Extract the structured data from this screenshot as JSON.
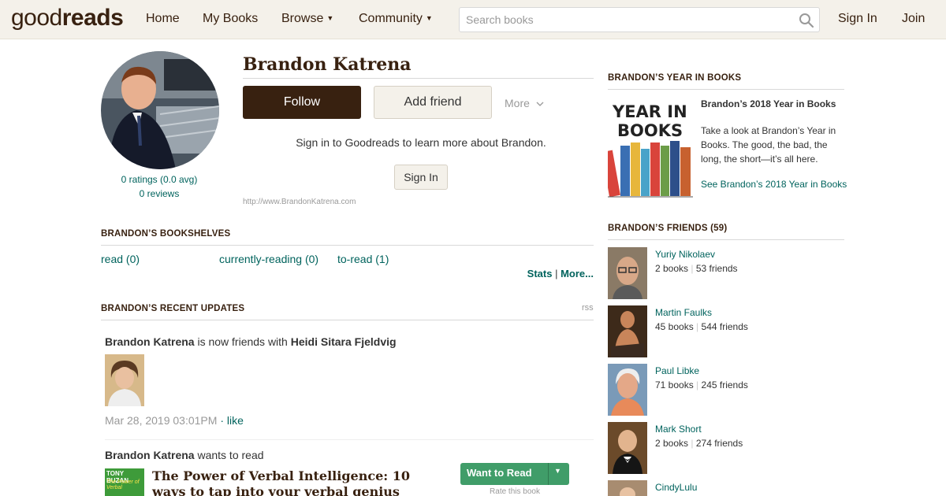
{
  "header": {
    "logo_light": "good",
    "logo_bold": "reads",
    "nav": [
      {
        "label": "Home"
      },
      {
        "label": "My Books"
      },
      {
        "label": "Browse"
      },
      {
        "label": "Community"
      }
    ],
    "search_placeholder": "Search books",
    "sign_in": "Sign In",
    "join": "Join"
  },
  "profile": {
    "name": "Brandon Katrena",
    "ratings": "0 ratings (0.0 avg)",
    "reviews": "0 reviews",
    "follow_label": "Follow",
    "add_friend_label": "Add friend",
    "more_label": "More",
    "signin_prompt": "Sign in to Goodreads to learn more about Brandon.",
    "signin_button": "Sign In",
    "website": "http://www.BrandonKatrena.com"
  },
  "bookshelves": {
    "title": "BRANDON’S BOOKSHELVES",
    "shelves": [
      {
        "label": "read (0)"
      },
      {
        "label": "currently-reading (0)"
      },
      {
        "label": "to-read (1)"
      }
    ],
    "stats_label": "Stats",
    "separator": "|",
    "more_label": "More..."
  },
  "updates": {
    "title": "BRANDON’S RECENT UPDATES",
    "rss": "rss",
    "items": [
      {
        "actor": "Brandon Katrena",
        "action": " is now friends with ",
        "target": "Heidi Sitara Fjeldvig",
        "date": "Mar 28, 2019 03:01PM",
        "like": "· like"
      },
      {
        "actor": "Brandon Katrena",
        "action": " wants to read",
        "book_title": "The Power of Verbal Intelligence: 10 ways to tap into your verbal genius",
        "cover_author": "TONY BUZAN",
        "cover_subtitle": "The Power of Verbal",
        "want_to_read": "Want to Read",
        "rate_book": "Rate this book"
      }
    ]
  },
  "year_in_books": {
    "title": "BRANDON’S YEAR IN BOOKS",
    "image_text_1": "YEAR IN",
    "image_text_2": "BOOKS",
    "heading": "Brandon’s 2018 Year in Books",
    "description": "Take a look at Brandon’s Year in Books. The good, the bad, the long, the short—it’s all here.",
    "link": "See Brandon’s 2018 Year in Books"
  },
  "friends": {
    "title": "BRANDON’S FRIENDS (59)",
    "separator": "|",
    "list": [
      {
        "name": "Yuriy Nikolaev",
        "books": "2 books",
        "friends": "53 friends"
      },
      {
        "name": "Martin Faulks",
        "books": "45 books",
        "friends": "544 friends"
      },
      {
        "name": "Paul Libke",
        "books": "71 books",
        "friends": "245 friends"
      },
      {
        "name": "Mark Short",
        "books": "2 books",
        "friends": "274 friends"
      },
      {
        "name": "CindyLulu",
        "books": "",
        "friends": ""
      }
    ]
  },
  "colors": {
    "brand_brown": "#382110",
    "header_bg": "#f4f1ea",
    "link_teal": "#00635d",
    "want_to_read_green": "#409d69"
  }
}
